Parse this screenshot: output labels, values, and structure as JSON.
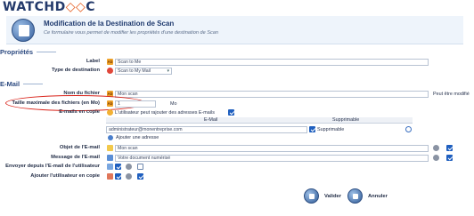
{
  "logo": {
    "text_a": "WATCHD",
    "text_sym": "◇◇",
    "text_b": "C"
  },
  "header": {
    "title": "Modification de la Destination de Scan",
    "subtitle": "Ce formulaire vous permet de modifier les propriétés d'une destination de Scan"
  },
  "sections": {
    "properties": "Propriétés",
    "email": "E-Mail"
  },
  "properties": {
    "label_label": "Label",
    "label_value": "Scan to Me",
    "dest_type_label": "Type de destination",
    "dest_type_value": "Scan to My Mail"
  },
  "email": {
    "filename_label": "Nom du fichier",
    "filename_value": "Mon scan",
    "filename_hint": "Peut être modifié",
    "maxsize_label": "Taille maximale des fichiers (en Mo)",
    "maxsize_value": "1",
    "maxsize_unit": "Mo",
    "cc_label": "E-mails en copie",
    "cc_text": "L'utilisateur peut rajouter des adresses E-mails",
    "grid_col_email": "E-Mail",
    "grid_col_deletable": "Supprimable",
    "grid_row_email": "administrateur@monentreprise.com",
    "grid_row_deletable": "Supprimable",
    "add_address": "Ajouter une adresse",
    "subject_label": "Objet de l'E-mail",
    "subject_value": "Mon scan",
    "message_label": "Message de l'E-mail",
    "message_value": "Votre document numérisé",
    "send_from_label": "Envoyer depuis l'E-mail de l'utilisateur",
    "add_cc_label": "Ajouter l'utilisateur en copie"
  },
  "buttons": {
    "validate": "Valider",
    "cancel": "Annuler"
  },
  "colors": {
    "accent": "#1f5fbf",
    "highlight": "#d9241b",
    "brand": "#243a6b",
    "brand_orange": "#e55a1c"
  }
}
